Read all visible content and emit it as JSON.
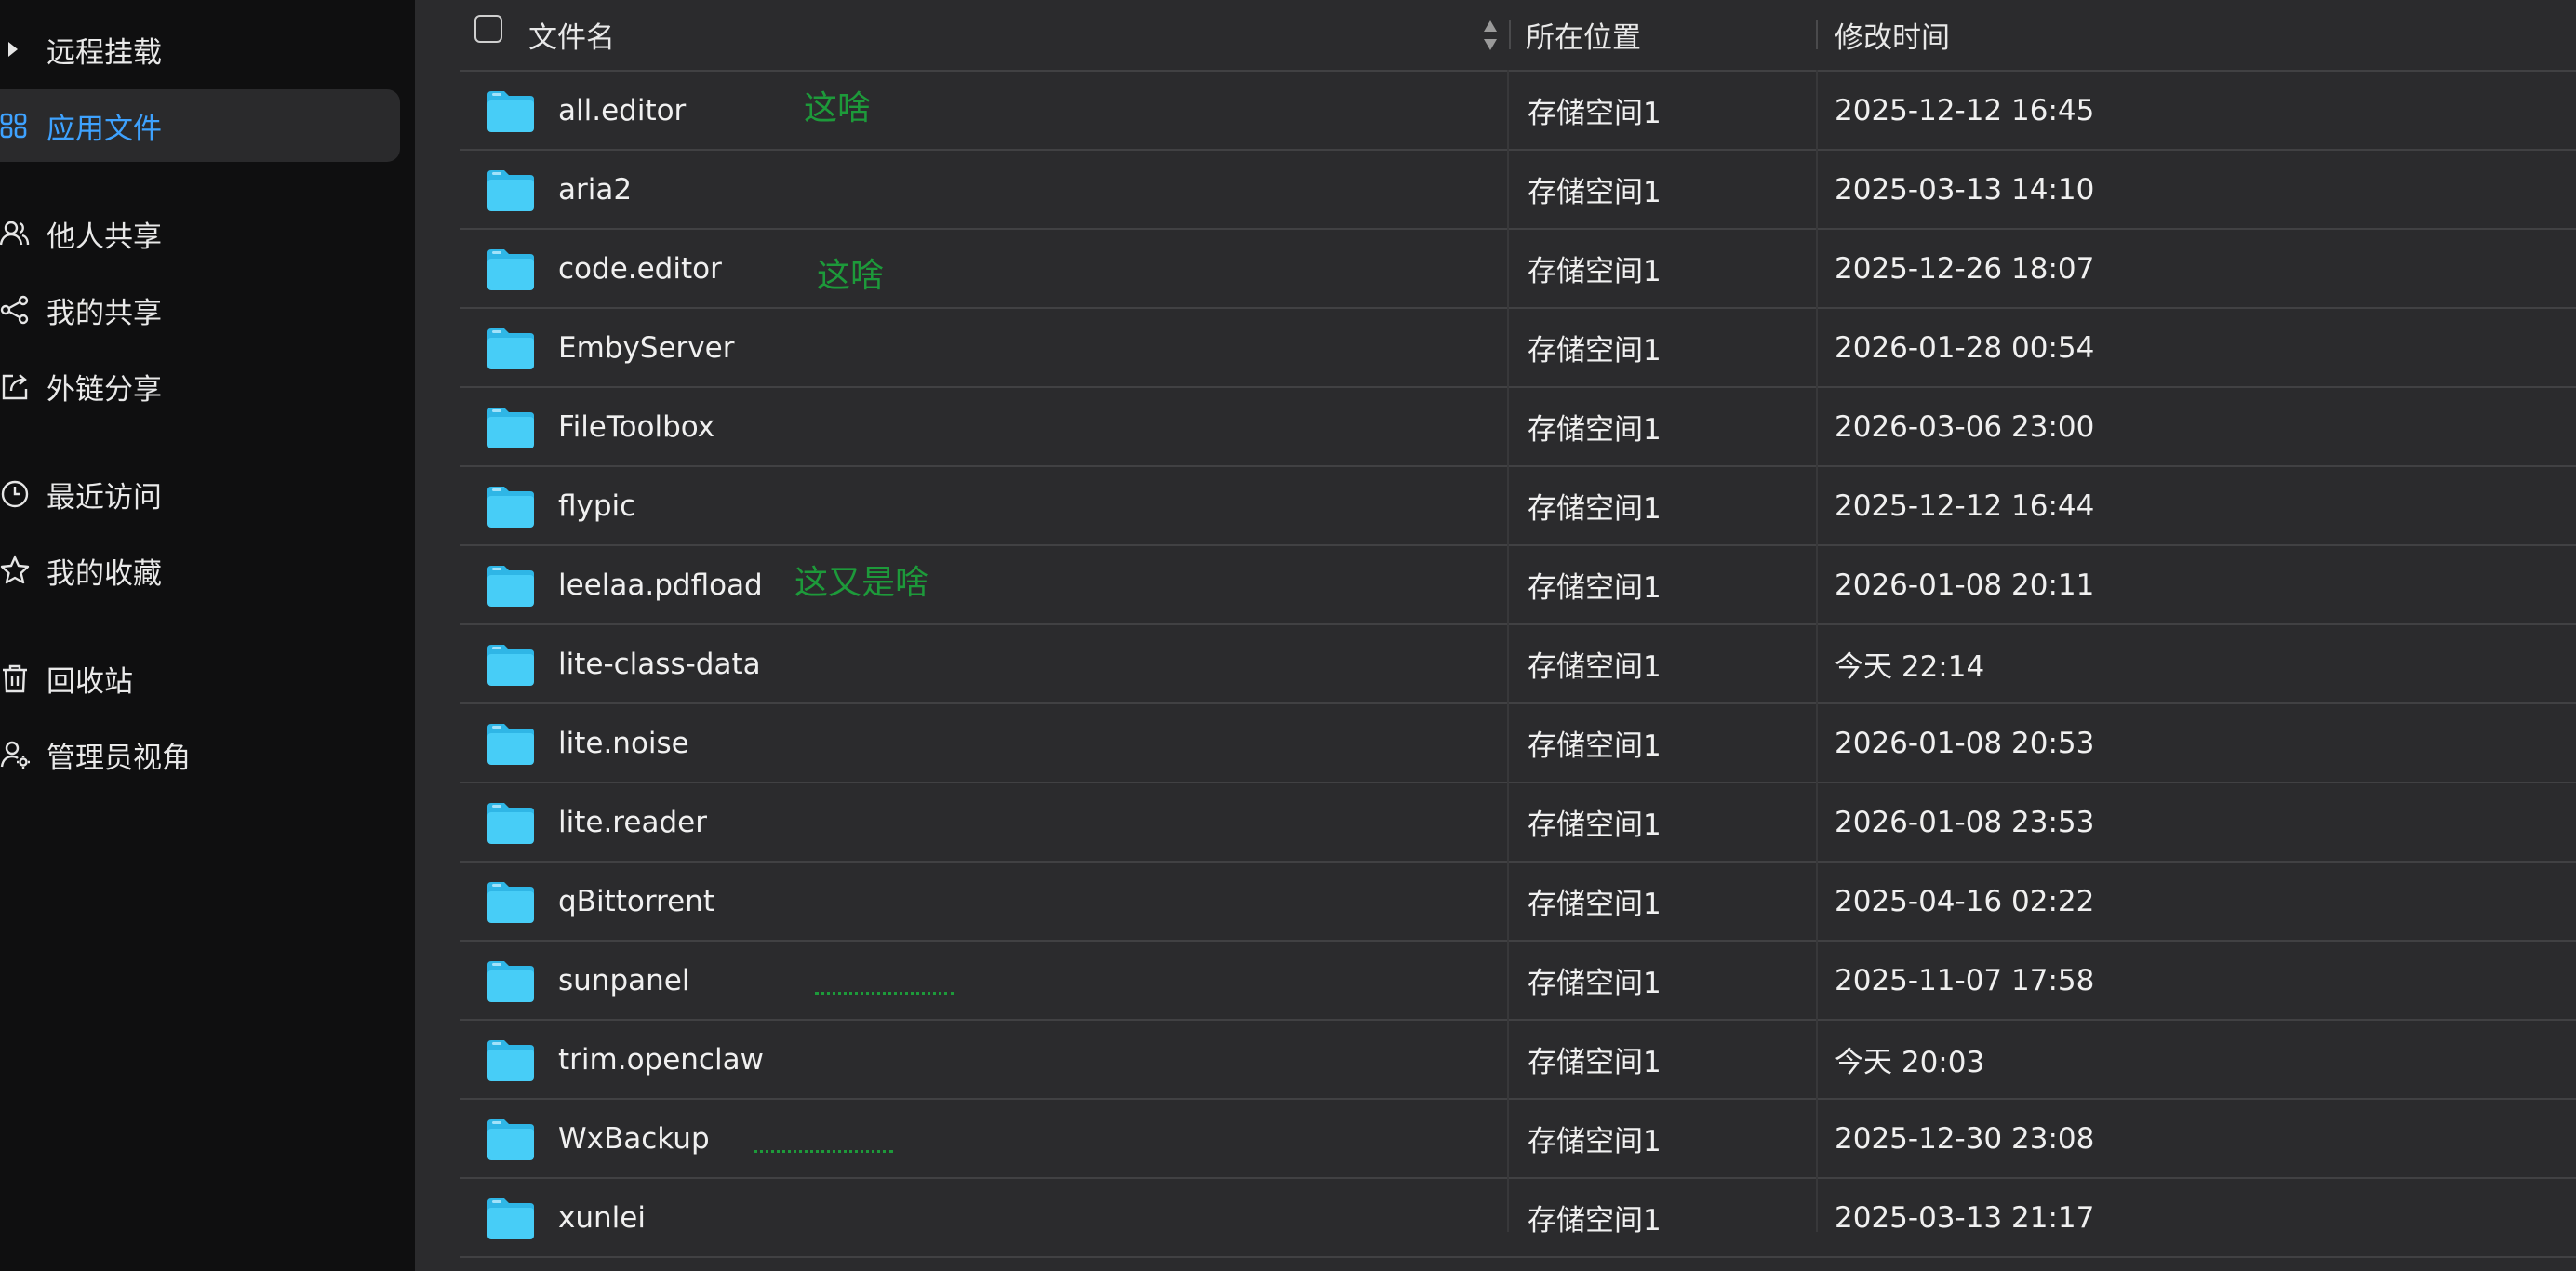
{
  "sidebar": {
    "items": [
      {
        "label": "远程挂载",
        "icon": "caret-right-icon",
        "active": false
      },
      {
        "label": "应用文件",
        "icon": "apps-grid-icon",
        "active": true
      },
      {
        "label": "他人共享",
        "icon": "users-icon",
        "active": false
      },
      {
        "label": "我的共享",
        "icon": "share-icon",
        "active": false
      },
      {
        "label": "外链分享",
        "icon": "external-link-icon",
        "active": false
      },
      {
        "label": "最近访问",
        "icon": "clock-icon",
        "active": false
      },
      {
        "label": "我的收藏",
        "icon": "star-icon",
        "active": false
      },
      {
        "label": "回收站",
        "icon": "trash-icon",
        "active": false
      },
      {
        "label": "管理员视角",
        "icon": "admin-user-icon",
        "active": false
      }
    ]
  },
  "table": {
    "headers": {
      "name": "文件名",
      "location": "所在位置",
      "modified": "修改时间"
    },
    "rows": [
      {
        "name": "all.editor",
        "location": "存储空间1",
        "modified": "2025-12-12 16:45",
        "note": "这啥"
      },
      {
        "name": "aria2",
        "location": "存储空间1",
        "modified": "2025-03-13 14:10"
      },
      {
        "name": "code.editor",
        "location": "存储空间1",
        "modified": "2025-12-26 18:07",
        "note": "这啥"
      },
      {
        "name": "EmbyServer",
        "location": "存储空间1",
        "modified": "2026-01-28 00:54"
      },
      {
        "name": "FileToolbox",
        "location": "存储空间1",
        "modified": "2026-03-06 23:00"
      },
      {
        "name": "flypic",
        "location": "存储空间1",
        "modified": "2025-12-12 16:44"
      },
      {
        "name": "leelaa.pdfload",
        "location": "存储空间1",
        "modified": "2026-01-08 20:11",
        "note": "这又是啥"
      },
      {
        "name": "lite-class-data",
        "location": "存储空间1",
        "modified": "今天 22:14"
      },
      {
        "name": "lite.noise",
        "location": "存储空间1",
        "modified": "2026-01-08 20:53"
      },
      {
        "name": "lite.reader",
        "location": "存储空间1",
        "modified": "2026-01-08 23:53"
      },
      {
        "name": "qBittorrent",
        "location": "存储空间1",
        "modified": "2025-04-16 02:22"
      },
      {
        "name": "sunpanel",
        "location": "存储空间1",
        "modified": "2025-11-07 17:58"
      },
      {
        "name": "trim.openclaw",
        "location": "存储空间1",
        "modified": "今天 20:03"
      },
      {
        "name": "WxBackup",
        "location": "存储空间1",
        "modified": "2025-12-30 23:08"
      },
      {
        "name": "xunlei",
        "location": "存储空间1",
        "modified": "2025-03-13 21:17"
      }
    ]
  },
  "colors": {
    "accent": "#3ea2ff",
    "folder": "#3ec7f5",
    "annotation": "#1d9a3a"
  }
}
